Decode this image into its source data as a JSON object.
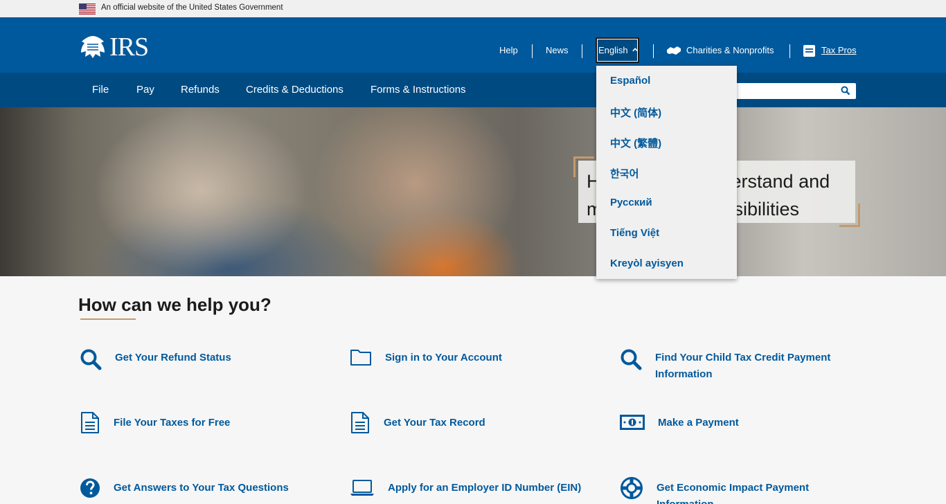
{
  "gov_banner": {
    "text": "An official website of the United States Government"
  },
  "header": {
    "logo_text": "IRS",
    "links": {
      "help": "Help",
      "news": "News",
      "charities": "Charities & Nonprofits",
      "tax_pros": "Tax Pros"
    },
    "language_selected": "English"
  },
  "nav": {
    "items": [
      "File",
      "Pay",
      "Refunds",
      "Credits & Deductions",
      "Forms & Instructions"
    ]
  },
  "search": {
    "placeholder": ""
  },
  "hero": {
    "line1": "H",
    "line1_end": "derstand and",
    "line2": "m",
    "line2_end": "onsibilities"
  },
  "language_menu": {
    "options": [
      "Español",
      "中文 (简体)",
      "中文 (繁體)",
      "한국어",
      "Русский",
      "Tiếng Việt",
      "Kreyòl ayisyen"
    ]
  },
  "help": {
    "title": "How can we help you?",
    "tasks": [
      {
        "label": "Get Your Refund Status",
        "icon": "search-icon"
      },
      {
        "label": "Sign in to Your Account",
        "icon": "folder-icon"
      },
      {
        "label": "Find Your Child Tax Credit Payment",
        "label2": "Information",
        "icon": "search-icon"
      },
      {
        "label": "File Your Taxes for Free",
        "icon": "document-icon"
      },
      {
        "label": "Get Your Tax Record",
        "icon": "document-icon"
      },
      {
        "label": "Make a Payment",
        "icon": "money-icon"
      },
      {
        "label": "Get Answers to Your Tax Questions",
        "icon": "question-icon"
      },
      {
        "label": "Apply for an Employer ID Number (EIN)",
        "icon": "laptop-icon"
      },
      {
        "label": "Get Economic Impact Payment",
        "label2": "Information",
        "icon": "lifebuoy-icon"
      }
    ]
  },
  "colors": {
    "header_blue": "#00599c",
    "nav_blue": "#004a82",
    "accent_gold": "#c49a6c",
    "link_blue": "#00599c"
  }
}
